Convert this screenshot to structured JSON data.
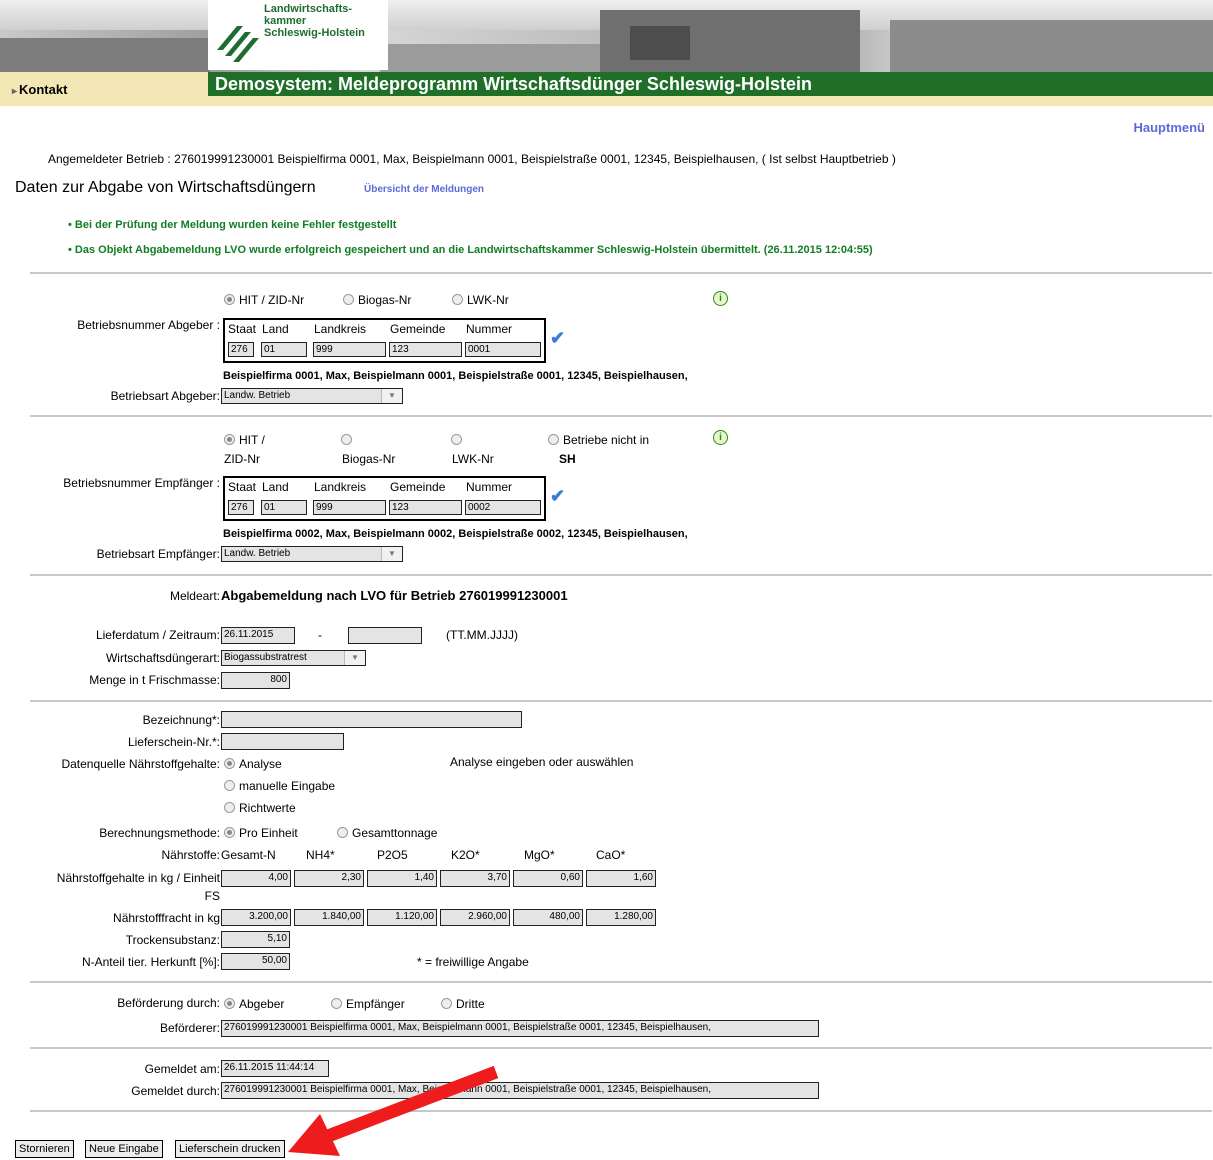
{
  "header": {
    "logo_line1": "Landwirtschafts-",
    "logo_line2": "kammer",
    "logo_line3": "Schleswig-Holstein",
    "title": "Demosystem: Meldeprogramm Wirtschaftsdünger Schleswig-Holstein",
    "nav_kontakt": "Kontakt",
    "nav_arrow": "▸",
    "main_menu": "Hauptmenü"
  },
  "betrieb_line": "Angemeldeter Betrieb : 276019991230001 Beispielfirma 0001, Max, Beispielmann 0001, Beispielstraße 0001, 12345, Beispielhausen, ( Ist selbst Hauptbetrieb )",
  "heading": "Daten zur Abgabe von Wirtschaftsdüngern",
  "overview_link": "Übersicht der Meldungen",
  "messages": [
    "Bei der Prüfung der Meldung wurden keine Fehler festgestellt",
    "Das Objekt Abgabemeldung LVO wurde erfolgreich gespeichert und an die Landwirtschaftskammer Schleswig-Holstein übermittelt. (26.11.2015 12:04:55)"
  ],
  "bullet": "•",
  "info_glyph": "i",
  "check_glyph": "✔",
  "dropdown_arrow": "▼",
  "column_labels": {
    "staat": "Staat",
    "land": "Land",
    "landkreis": "Landkreis",
    "gemeinde": "Gemeinde",
    "nummer": "Nummer"
  },
  "abgeber": {
    "radio_hit": "HIT / ZID-Nr",
    "radio_biogas": "Biogas-Nr",
    "radio_lwk": "LWK-Nr",
    "label": "Betriebsnummer Abgeber :",
    "staat": "276",
    "land": "01",
    "landkreis": "999",
    "gemeinde": "123",
    "nummer": "0001",
    "name": "Beispielfirma 0001, Max, Beispielmann 0001, Beispielstraße 0001, 12345, Beispielhausen,",
    "art_label": "Betriebsart Abgeber:",
    "art_value": "Landw. Betrieb"
  },
  "empfaenger": {
    "radio_hit_1": "HIT /",
    "radio_hit_2": "ZID-Nr",
    "radio_biogas": "Biogas-Nr",
    "radio_lwk": "LWK-Nr",
    "radio_nicht_1": "Betriebe nicht in",
    "radio_nicht_2": "SH",
    "label": "Betriebsnummer Empfänger :",
    "staat": "276",
    "land": "01",
    "landkreis": "999",
    "gemeinde": "123",
    "nummer": "0002",
    "name": "Beispielfirma 0002, Max, Beispielmann 0002, Beispielstraße 0002, 12345, Beispielhausen,",
    "art_label": "Betriebsart Empfänger:",
    "art_value": "Landw. Betrieb"
  },
  "meldeart": {
    "label": "Meldeart:",
    "value": "Abgabemeldung nach LVO für Betrieb 276019991230001"
  },
  "lieferung": {
    "datum_label": "Lieferdatum / Zeitraum:",
    "datum_from": "26.11.2015",
    "dash": "-",
    "datum_to": "",
    "format_hint": "(TT.MM.JJJJ)",
    "art_label": "Wirtschaftsdüngerart:",
    "art_value": "Biogassubstratrest",
    "menge_label": "Menge in t Frischmasse:",
    "menge_value": "800"
  },
  "naehrstoff": {
    "bezeichnung_label": "Bezeichnung*:",
    "bezeichnung_value": "",
    "lieferschein_label": "Lieferschein-Nr.*:",
    "lieferschein_value": "",
    "quelle_label": "Datenquelle Nährstoffgehalte:",
    "quelle_options": [
      "Analyse",
      "manuelle Eingabe",
      "Richtwerte"
    ],
    "analyse_hint": "Analyse eingeben oder auswählen",
    "methode_label": "Berechnungsmethode:",
    "methode_options": [
      "Pro Einheit",
      "Gesamttonnage"
    ],
    "stoffe_label": "Nährstoffe:",
    "stoffe": [
      "Gesamt-N",
      "NH4*",
      "P2O5",
      "K2O*",
      "MgO*",
      "CaO*"
    ],
    "gehalte_label_1": "Nährstoffgehalte in kg / Einheit",
    "gehalte_label_2": "FS",
    "gehalte": [
      "4,00",
      "2,30",
      "1,40",
      "3,70",
      "0,60",
      "1,60"
    ],
    "fracht_label": "Nährstofffracht in kg",
    "fracht": [
      "3.200,00",
      "1.840,00",
      "1.120,00",
      "2.960,00",
      "480,00",
      "1.280,00"
    ],
    "trocken_label": "Trockensubstanz:",
    "trocken_value": "5,10",
    "nanteil_label": "N-Anteil tier. Herkunft [%]:",
    "nanteil_value": "50,00",
    "freiwillig": "* = freiwillige Angabe"
  },
  "befoerderung": {
    "label": "Beförderung durch:",
    "options": [
      "Abgeber",
      "Empfänger",
      "Dritte"
    ],
    "befoerderer_label": "Beförderer:",
    "befoerderer_value": "276019991230001 Beispielfirma 0001, Max, Beispielmann 0001, Beispielstraße 0001, 12345, Beispielhausen,"
  },
  "gemeldet": {
    "am_label": "Gemeldet am:",
    "am_value": "26.11.2015 11:44:14",
    "durch_label": "Gemeldet durch:",
    "durch_value": "276019991230001 Beispielfirma 0001, Max, Beispielmann 0001, Beispielstraße 0001, 12345, Beispielhausen,"
  },
  "buttons": {
    "stornieren": "Stornieren",
    "neue_eingabe": "Neue Eingabe",
    "lieferschein_drucken": "Lieferschein drucken"
  },
  "colors": {
    "title_bar": "#1f6f28",
    "nav_bar": "#f3e7b6",
    "success_text": "#127d24",
    "link": "#5b6bd6",
    "annotation_arrow": "#ee1c1c"
  }
}
